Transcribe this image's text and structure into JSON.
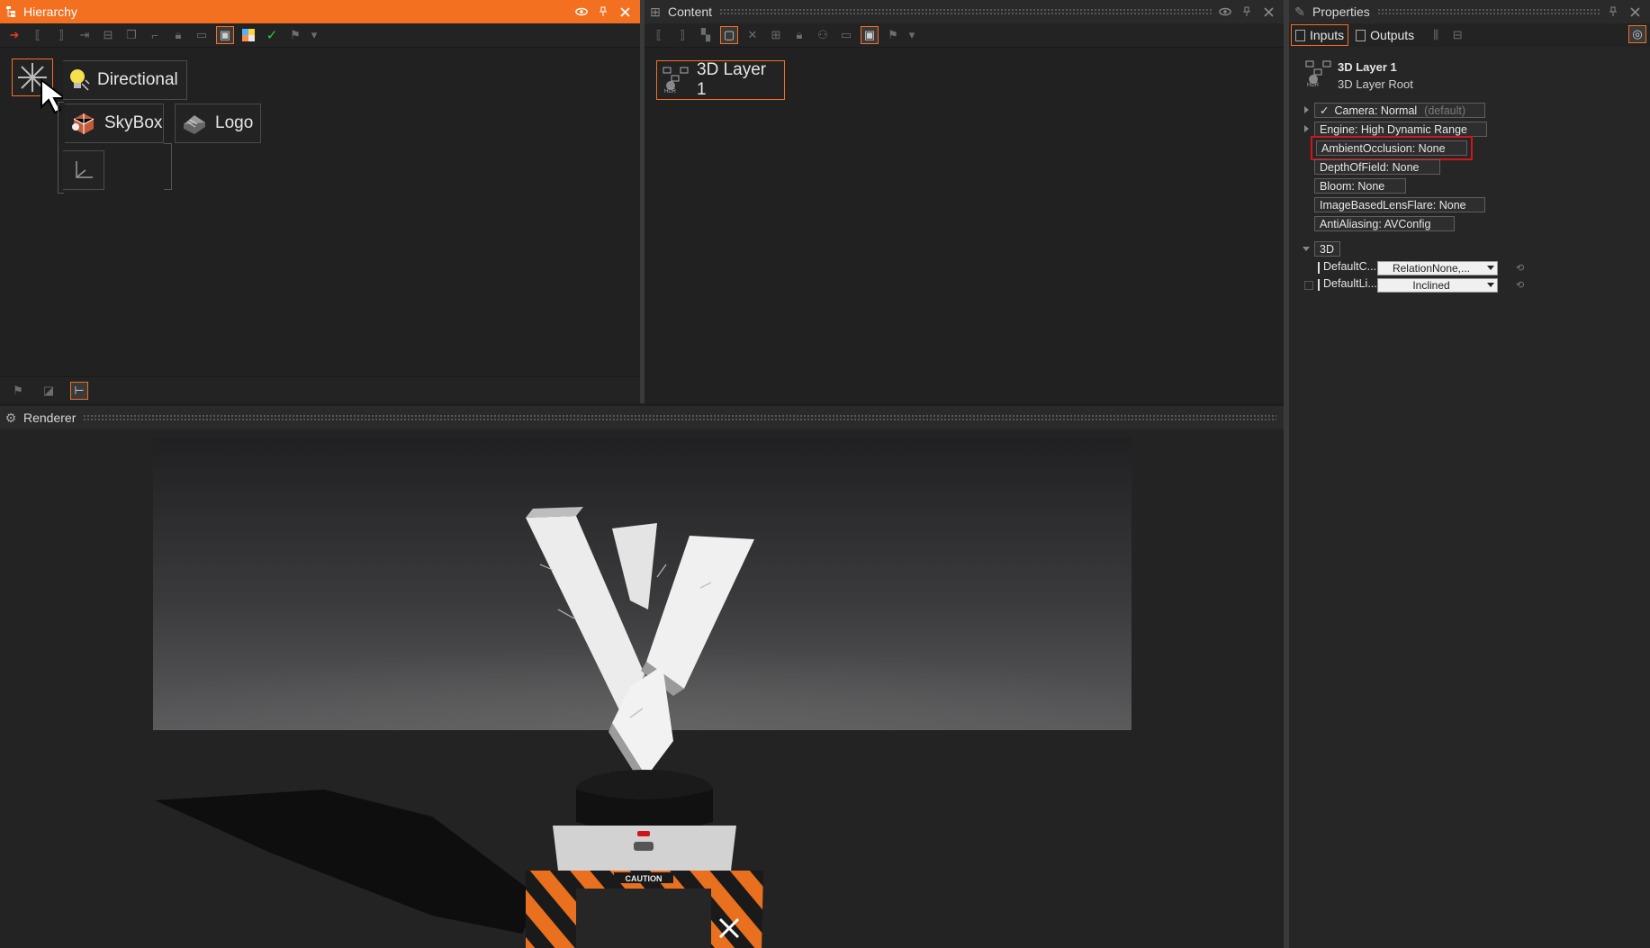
{
  "hierarchy": {
    "title": "Hierarchy",
    "nodes": {
      "directional": "Directional",
      "skybox": "SkyBox",
      "logo": "Logo"
    }
  },
  "content": {
    "title": "Content",
    "layer_label": "3D Layer 1"
  },
  "properties": {
    "title": "Properties",
    "tabs": {
      "inputs": "Inputs",
      "outputs": "Outputs"
    },
    "header": {
      "name": "3D Layer 1",
      "subtitle": "3D Layer Root"
    },
    "rows": {
      "camera": "Camera:  Normal",
      "camera_hint": "(default)",
      "engine": "Engine:  High Dynamic Range",
      "ambient_occlusion": "AmbientOcclusion:  None",
      "depth_of_field": "DepthOfField:  None",
      "bloom": "Bloom:  None",
      "lens_flare": "ImageBasedLensFlare:  None",
      "anti_aliasing": "AntiAliasing:  AVConfig"
    },
    "group_3d": {
      "label": "3D",
      "default_camera_label": "DefaultC...",
      "default_camera_value": "RelationNone,...",
      "default_light_label": "DefaultLi...",
      "default_light_value": "Inclined"
    }
  },
  "renderer": {
    "title": "Renderer",
    "caution_text": "CAUTION"
  },
  "colors": {
    "accent": "#f37021",
    "highlight_red": "#d0161d",
    "panel_bg": "#262626"
  }
}
